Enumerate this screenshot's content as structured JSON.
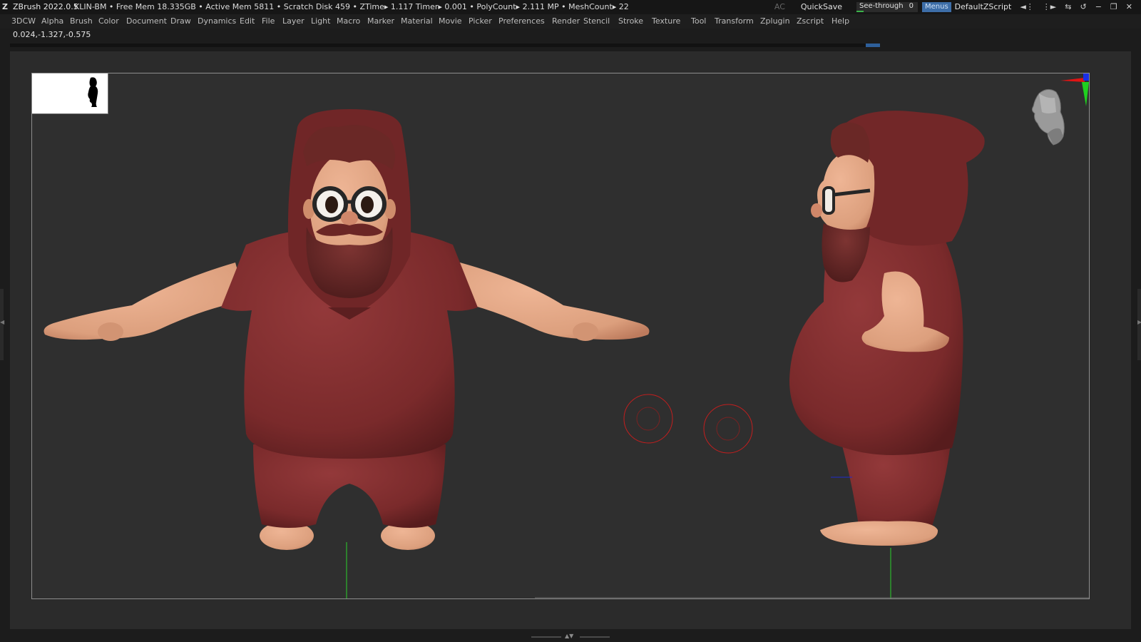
{
  "titlebar": {
    "logo": "Z",
    "app_name": "ZBrush 2022.0.5",
    "stats": "KLIN-BM   • Free Mem 18.335GB • Active Mem 5811 • Scratch Disk 459 •  ZTime▸ 1.117 Timer▸ 0.001 • PolyCount▸ 2.111 MP  • MeshCount▸ 22",
    "ac_label": "AC",
    "quicksave_label": "QuickSave",
    "seethrough_label": "See-through",
    "seethrough_value": "0",
    "menus_label": "Menus",
    "zscript_label": "DefaultZScript"
  },
  "menubar": {
    "items": [
      "3DCW",
      "Alpha",
      "Brush",
      "Color",
      "Document",
      "Draw",
      "Dynamics",
      "Edit",
      "File",
      "Layer",
      "Light",
      "Macro",
      "Marker",
      "Material",
      "Movie",
      "Picker",
      "Preferences",
      "Render",
      "Stencil",
      "Stroke",
      "Texture",
      "Tool",
      "Transform",
      "Zplugin",
      "Zscript",
      "Help"
    ]
  },
  "coords": "0.024,-1.327,-0.575",
  "colors": {
    "cloth": "#7c2b2b",
    "cloth_shadow": "#5e1f20",
    "skin": "#e0a583",
    "skin_shadow": "#c68163",
    "hair": "#6e2a28",
    "glasses": "#2a2a2a",
    "axis_red": "#e01414",
    "axis_green": "#1fd01f",
    "axis_blue": "#1a2fe6",
    "ring": "#c41e1e",
    "ground_line": "#2bd12b"
  },
  "icons": {
    "logo": "zbrush-logo-icon",
    "axis": "axis-gizmo-icon",
    "navigator": "navigator-head-icon"
  }
}
